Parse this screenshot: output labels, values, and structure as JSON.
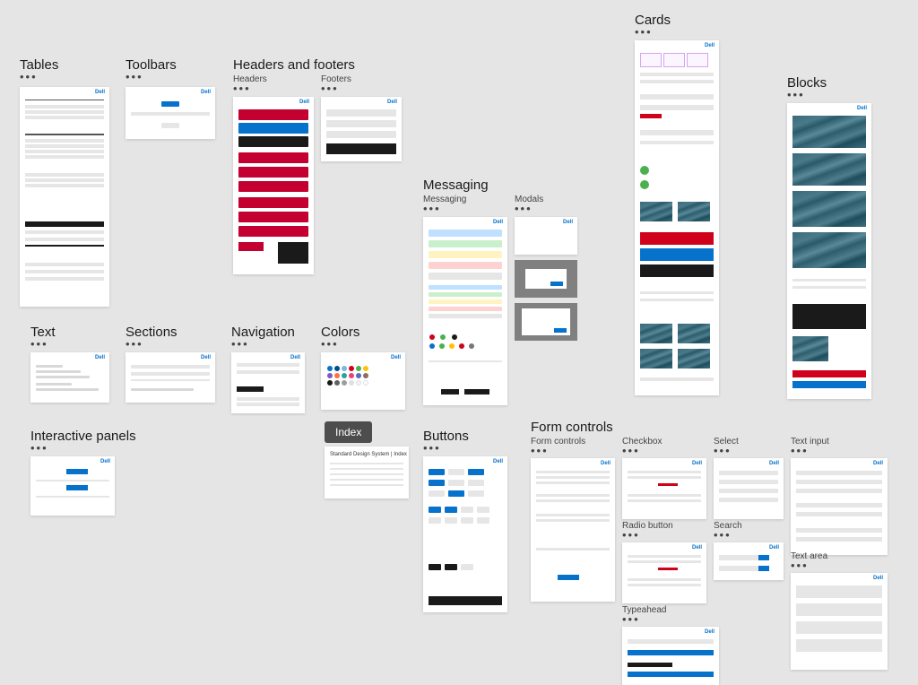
{
  "brand": "Dell",
  "groups": {
    "tables": "Tables",
    "toolbars": "Toolbars",
    "headersFooters": "Headers and footers",
    "headers": "Headers",
    "footers": "Footers",
    "text": "Text",
    "sections": "Sections",
    "navigation": "Navigation",
    "colors": "Colors",
    "interactivePanels": "Interactive panels",
    "index": "Index",
    "indexPageTitle": "Standard Design System | Index",
    "buttons": "Buttons",
    "messaging": "Messaging",
    "messagingSub": "Messaging",
    "modals": "Modals",
    "cards": "Cards",
    "blocks": "Blocks",
    "formControls": "Form controls",
    "formControlsSub": "Form controls",
    "checkbox": "Checkbox",
    "select": "Select",
    "textInput": "Text input",
    "radioButton": "Radio button",
    "search": "Search",
    "typeahead": "Typeahead",
    "textArea": "Text area"
  },
  "colors": {
    "headerRed": "#c3002f",
    "headerBlue": "#0672cb",
    "headerBlack": "#1a1a1a",
    "msgBlue": "#bfe1ff",
    "msgGreen": "#c9f0cb",
    "msgYellow": "#fff3c2",
    "msgRed": "#ffd2d2",
    "msgGray": "#e6e6e6"
  },
  "dots": "•••"
}
